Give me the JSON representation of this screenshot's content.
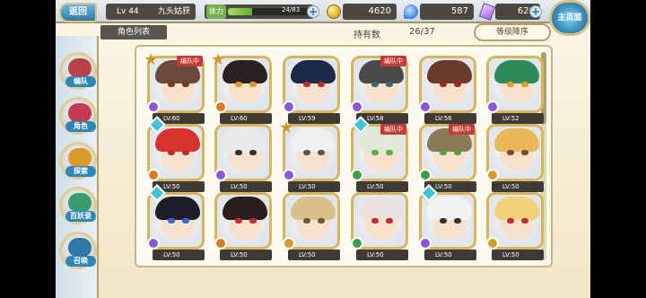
{
  "header": {
    "back_label": "返回",
    "player_level": "Lv 44",
    "player_name": "九头姑获",
    "stamina_label": "体力",
    "stamina_text": "24/83",
    "stamina_fraction": 0.29,
    "gold": "4620",
    "soul": "587",
    "gem": "620",
    "home_label": "主页面",
    "colors": {
      "accent": "#2f79a6",
      "gold_frame": "#d8b45c",
      "team_red": "#c63b36"
    }
  },
  "subbar": {
    "tab_label": "角色列表",
    "owned_label": "持有数",
    "owned_count": "26/37",
    "sort_label": "等级降序"
  },
  "side_menu": [
    {
      "label": "编队",
      "icon": "formation-icon",
      "color": "#b9424a"
    },
    {
      "label": "角色",
      "icon": "character-icon",
      "color": "#c33a52"
    },
    {
      "label": "探索",
      "icon": "explore-icon",
      "color": "#d79b2a"
    },
    {
      "label": "百妖录",
      "icon": "codex-icon",
      "color": "#3b9c6e"
    },
    {
      "label": "召唤",
      "icon": "summon-icon",
      "color": "#2f79a6"
    }
  ],
  "characters": [
    {
      "level": "LV:60",
      "badge": "编队中",
      "mark": "star",
      "hair": "#6a4a3a",
      "eye": "#7a3b20",
      "elem": "#8a5ad6"
    },
    {
      "level": "LV:60",
      "badge": "",
      "mark": "star",
      "hair": "#2a2220",
      "eye": "#d79b2a",
      "elem": "#e07a22"
    },
    {
      "level": "LV:59",
      "badge": "",
      "mark": "",
      "hair": "#1c2a4a",
      "eye": "#c22c2c",
      "elem": "#8a5ad6"
    },
    {
      "level": "LV:58",
      "badge": "编队中",
      "mark": "",
      "hair": "#4a4a4a",
      "eye": "#3c6a6a",
      "elem": "#8a5ad6"
    },
    {
      "level": "LV:56",
      "badge": "",
      "mark": "",
      "hair": "#6a3a2a",
      "eye": "#9a2a2a",
      "elem": "#8a5ad6"
    },
    {
      "level": "LV:52",
      "badge": "",
      "mark": "",
      "hair": "#2f8a5a",
      "eye": "#d7a02a",
      "elem": "#8a5ad6"
    },
    {
      "level": "LV:50",
      "badge": "",
      "mark": "diamond",
      "hair": "#d8322c",
      "eye": "#c22c2c",
      "elem": "#e07a22"
    },
    {
      "level": "LV:50",
      "badge": "",
      "mark": "",
      "hair": "#e9e9e9",
      "eye": "#333333",
      "elem": "#8a5ad6"
    },
    {
      "level": "LV:50",
      "badge": "",
      "mark": "star",
      "hair": "#f0f0f0",
      "eye": "#555555",
      "elem": "#8a5ad6"
    },
    {
      "level": "LV:50",
      "badge": "编队中",
      "mark": "diamond",
      "hair": "#dfe9d5",
      "eye": "#5ab040",
      "elem": "#3aa04a"
    },
    {
      "level": "LV:50",
      "badge": "编队中",
      "mark": "",
      "hair": "#8a7a5a",
      "eye": "#5aa04a",
      "elem": "#3aa04a"
    },
    {
      "level": "LV:50",
      "badge": "",
      "mark": "",
      "hair": "#e8b85a",
      "eye": "#7a4a2a",
      "elem": "#d79b2a"
    },
    {
      "level": "LV:50",
      "badge": "",
      "mark": "diamond",
      "hair": "#1e1e2a",
      "eye": "#3a6ad0",
      "elem": "#8a5ad6"
    },
    {
      "level": "LV:50",
      "badge": "",
      "mark": "",
      "hair": "#2a1e1e",
      "eye": "#c22c2c",
      "elem": "#e07a22"
    },
    {
      "level": "LV:50",
      "badge": "",
      "mark": "",
      "hair": "#d9c08a",
      "eye": "#6a5a3a",
      "elem": "#d79b2a"
    },
    {
      "level": "LV:50",
      "badge": "",
      "mark": "",
      "hair": "#e9e2df",
      "eye": "#c22c2c",
      "elem": "#3aa04a"
    },
    {
      "level": "LV:50",
      "badge": "",
      "mark": "diamond",
      "hair": "#f2f2f2",
      "eye": "#333333",
      "elem": "#8a5ad6"
    },
    {
      "level": "LV:50",
      "badge": "",
      "mark": "",
      "hair": "#f1d27a",
      "eye": "#c22c2c",
      "elem": "#d79b2a"
    }
  ]
}
